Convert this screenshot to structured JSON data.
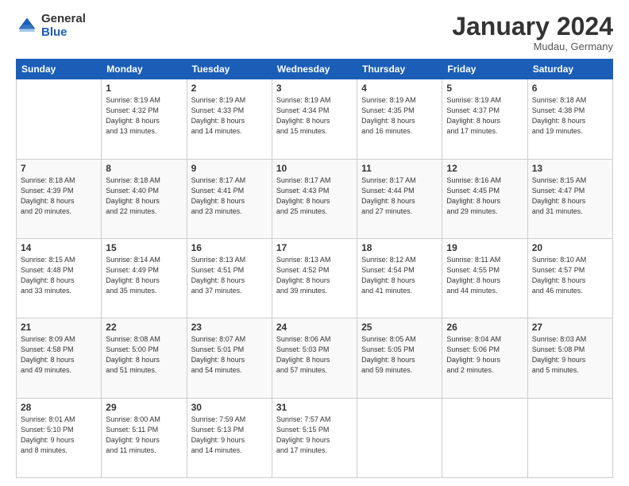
{
  "logo": {
    "general": "General",
    "blue": "Blue"
  },
  "header": {
    "month": "January 2024",
    "location": "Mudau, Germany"
  },
  "weekdays": [
    "Sunday",
    "Monday",
    "Tuesday",
    "Wednesday",
    "Thursday",
    "Friday",
    "Saturday"
  ],
  "weeks": [
    [
      {
        "day": "",
        "info": ""
      },
      {
        "day": "1",
        "info": "Sunrise: 8:19 AM\nSunset: 4:32 PM\nDaylight: 8 hours\nand 13 minutes."
      },
      {
        "day": "2",
        "info": "Sunrise: 8:19 AM\nSunset: 4:33 PM\nDaylight: 8 hours\nand 14 minutes."
      },
      {
        "day": "3",
        "info": "Sunrise: 8:19 AM\nSunset: 4:34 PM\nDaylight: 8 hours\nand 15 minutes."
      },
      {
        "day": "4",
        "info": "Sunrise: 8:19 AM\nSunset: 4:35 PM\nDaylight: 8 hours\nand 16 minutes."
      },
      {
        "day": "5",
        "info": "Sunrise: 8:19 AM\nSunset: 4:37 PM\nDaylight: 8 hours\nand 17 minutes."
      },
      {
        "day": "6",
        "info": "Sunrise: 8:18 AM\nSunset: 4:38 PM\nDaylight: 8 hours\nand 19 minutes."
      }
    ],
    [
      {
        "day": "7",
        "info": "Sunrise: 8:18 AM\nSunset: 4:39 PM\nDaylight: 8 hours\nand 20 minutes."
      },
      {
        "day": "8",
        "info": "Sunrise: 8:18 AM\nSunset: 4:40 PM\nDaylight: 8 hours\nand 22 minutes."
      },
      {
        "day": "9",
        "info": "Sunrise: 8:17 AM\nSunset: 4:41 PM\nDaylight: 8 hours\nand 23 minutes."
      },
      {
        "day": "10",
        "info": "Sunrise: 8:17 AM\nSunset: 4:43 PM\nDaylight: 8 hours\nand 25 minutes."
      },
      {
        "day": "11",
        "info": "Sunrise: 8:17 AM\nSunset: 4:44 PM\nDaylight: 8 hours\nand 27 minutes."
      },
      {
        "day": "12",
        "info": "Sunrise: 8:16 AM\nSunset: 4:45 PM\nDaylight: 8 hours\nand 29 minutes."
      },
      {
        "day": "13",
        "info": "Sunrise: 8:15 AM\nSunset: 4:47 PM\nDaylight: 8 hours\nand 31 minutes."
      }
    ],
    [
      {
        "day": "14",
        "info": "Sunrise: 8:15 AM\nSunset: 4:48 PM\nDaylight: 8 hours\nand 33 minutes."
      },
      {
        "day": "15",
        "info": "Sunrise: 8:14 AM\nSunset: 4:49 PM\nDaylight: 8 hours\nand 35 minutes."
      },
      {
        "day": "16",
        "info": "Sunrise: 8:13 AM\nSunset: 4:51 PM\nDaylight: 8 hours\nand 37 minutes."
      },
      {
        "day": "17",
        "info": "Sunrise: 8:13 AM\nSunset: 4:52 PM\nDaylight: 8 hours\nand 39 minutes."
      },
      {
        "day": "18",
        "info": "Sunrise: 8:12 AM\nSunset: 4:54 PM\nDaylight: 8 hours\nand 41 minutes."
      },
      {
        "day": "19",
        "info": "Sunrise: 8:11 AM\nSunset: 4:55 PM\nDaylight: 8 hours\nand 44 minutes."
      },
      {
        "day": "20",
        "info": "Sunrise: 8:10 AM\nSunset: 4:57 PM\nDaylight: 8 hours\nand 46 minutes."
      }
    ],
    [
      {
        "day": "21",
        "info": "Sunrise: 8:09 AM\nSunset: 4:58 PM\nDaylight: 8 hours\nand 49 minutes."
      },
      {
        "day": "22",
        "info": "Sunrise: 8:08 AM\nSunset: 5:00 PM\nDaylight: 8 hours\nand 51 minutes."
      },
      {
        "day": "23",
        "info": "Sunrise: 8:07 AM\nSunset: 5:01 PM\nDaylight: 8 hours\nand 54 minutes."
      },
      {
        "day": "24",
        "info": "Sunrise: 8:06 AM\nSunset: 5:03 PM\nDaylight: 8 hours\nand 57 minutes."
      },
      {
        "day": "25",
        "info": "Sunrise: 8:05 AM\nSunset: 5:05 PM\nDaylight: 8 hours\nand 59 minutes."
      },
      {
        "day": "26",
        "info": "Sunrise: 8:04 AM\nSunset: 5:06 PM\nDaylight: 9 hours\nand 2 minutes."
      },
      {
        "day": "27",
        "info": "Sunrise: 8:03 AM\nSunset: 5:08 PM\nDaylight: 9 hours\nand 5 minutes."
      }
    ],
    [
      {
        "day": "28",
        "info": "Sunrise: 8:01 AM\nSunset: 5:10 PM\nDaylight: 9 hours\nand 8 minutes."
      },
      {
        "day": "29",
        "info": "Sunrise: 8:00 AM\nSunset: 5:11 PM\nDaylight: 9 hours\nand 11 minutes."
      },
      {
        "day": "30",
        "info": "Sunrise: 7:59 AM\nSunset: 5:13 PM\nDaylight: 9 hours\nand 14 minutes."
      },
      {
        "day": "31",
        "info": "Sunrise: 7:57 AM\nSunset: 5:15 PM\nDaylight: 9 hours\nand 17 minutes."
      },
      {
        "day": "",
        "info": ""
      },
      {
        "day": "",
        "info": ""
      },
      {
        "day": "",
        "info": ""
      }
    ]
  ]
}
